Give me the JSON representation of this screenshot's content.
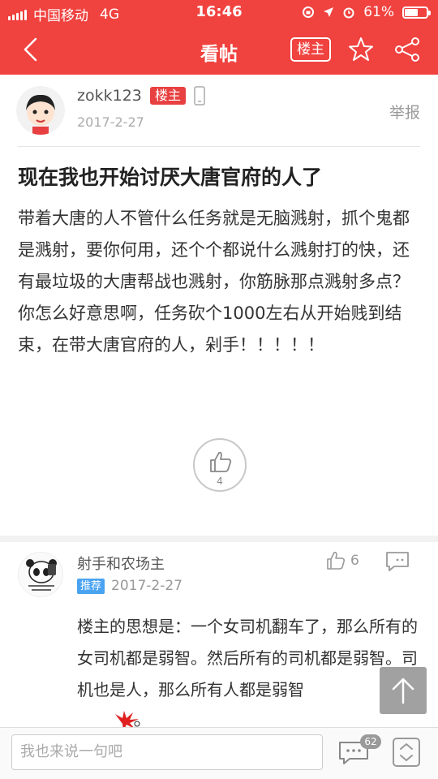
{
  "status_bar": {
    "carrier": "中国移动",
    "network": "4G",
    "time": "16:46",
    "battery": "61%",
    "battery_level": 0.61
  },
  "header": {
    "title": "看帖",
    "owner_only_label": "楼主",
    "icons": [
      "back-icon",
      "star-icon",
      "share-icon"
    ],
    "background_color": "#f0423f"
  },
  "post": {
    "author": "zokk123",
    "author_badge": "楼主",
    "date": "2017-2-27",
    "report_label": "举报",
    "title": "现在我也开始讨厌大唐官府的人了",
    "body": "带着大唐的人不管什么任务就是无脑溅射，抓个鬼都是溅射，要你何用，还个个都说什么溅射打的快，还有最垃圾的大唐帮战也溅射，你筋脉那点溅射多点？你怎么好意思啊，任务砍个1000左右从开始贱到结束，在带大唐官府的人，剁手！！！！！",
    "like_count": "4"
  },
  "reply": {
    "author": "射手和农场主",
    "badge": "推荐",
    "date": "2017-2-27",
    "like_count": "6",
    "body": "楼主的思想是：一个女司机翻车了，那么所有的女司机都是弱智。然后所有的司机都是弱智。司机也是人，那么所有人都是弱智"
  },
  "bottom_bar": {
    "reply_placeholder": "我也来说一句吧",
    "comment_count": "62"
  }
}
